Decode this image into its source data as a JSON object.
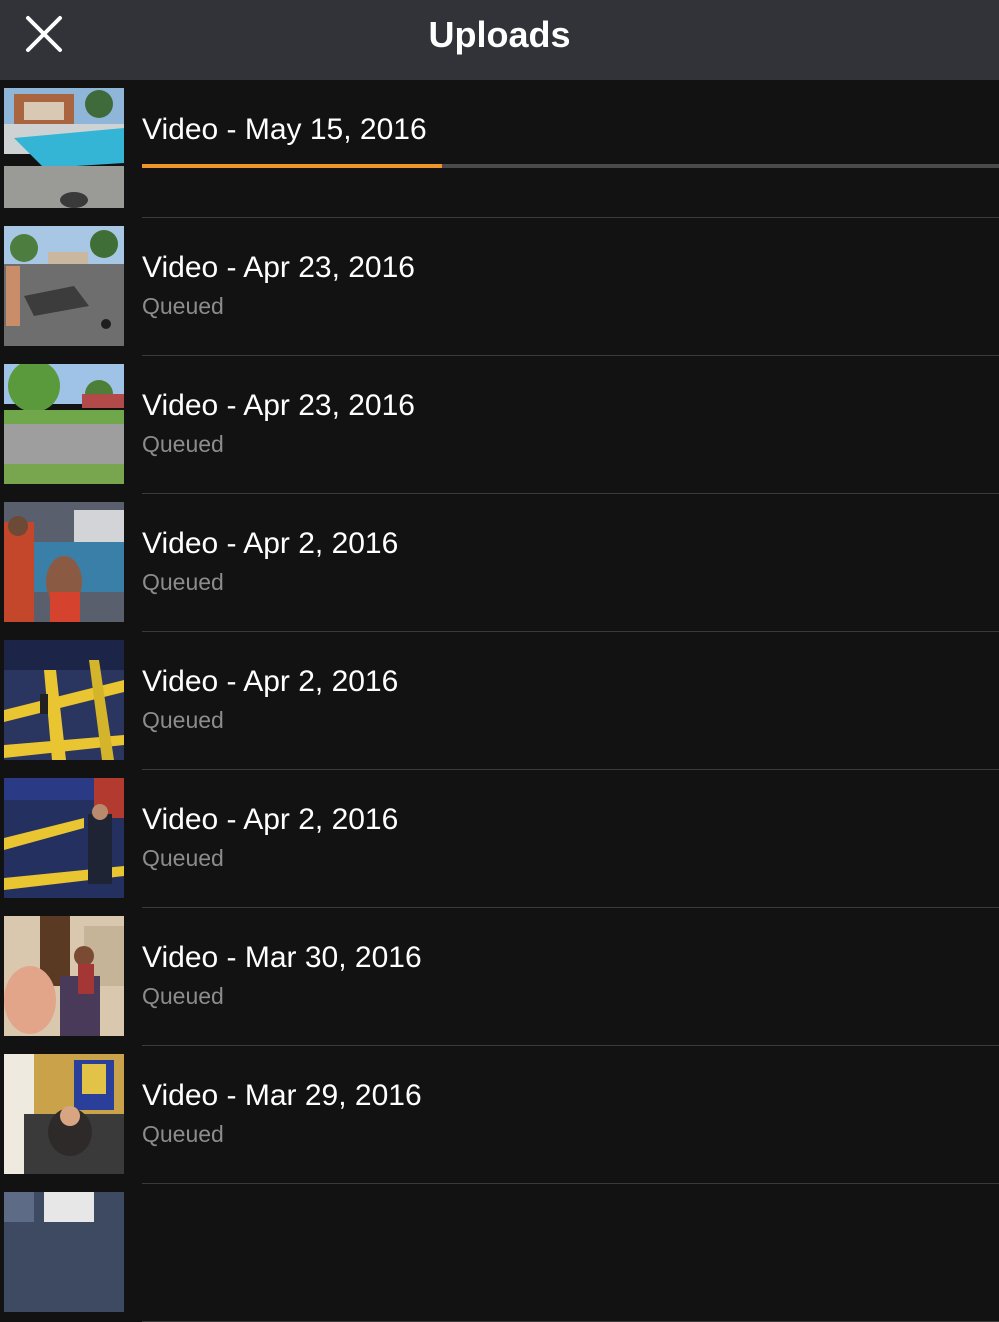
{
  "header": {
    "title": "Uploads",
    "close_icon": "close-icon"
  },
  "colors": {
    "nav_background": "#323339",
    "background": "#121212",
    "progress_accent": "#f0952a"
  },
  "uploads": [
    {
      "title": "Video - May 15, 2016",
      "status": "",
      "progress": 0.35,
      "thumbnail": "pool"
    },
    {
      "title": "Video - Apr 23, 2016",
      "status": "Queued",
      "thumbnail": "street-play"
    },
    {
      "title": "Video - Apr 23, 2016",
      "status": "Queued",
      "thumbnail": "street-trees"
    },
    {
      "title": "Video - Apr 2, 2016",
      "status": "Queued",
      "thumbnail": "trampoline-kids"
    },
    {
      "title": "Video - Apr 2, 2016",
      "status": "Queued",
      "thumbnail": "trampoline-yellow"
    },
    {
      "title": "Video - Apr 2, 2016",
      "status": "Queued",
      "thumbnail": "trampoline-boys"
    },
    {
      "title": "Video - Mar 30, 2016",
      "status": "Queued",
      "thumbnail": "living-room"
    },
    {
      "title": "Video - Mar 29, 2016",
      "status": "Queued",
      "thumbnail": "party"
    },
    {
      "title": "",
      "status": "",
      "thumbnail": "partial"
    }
  ]
}
